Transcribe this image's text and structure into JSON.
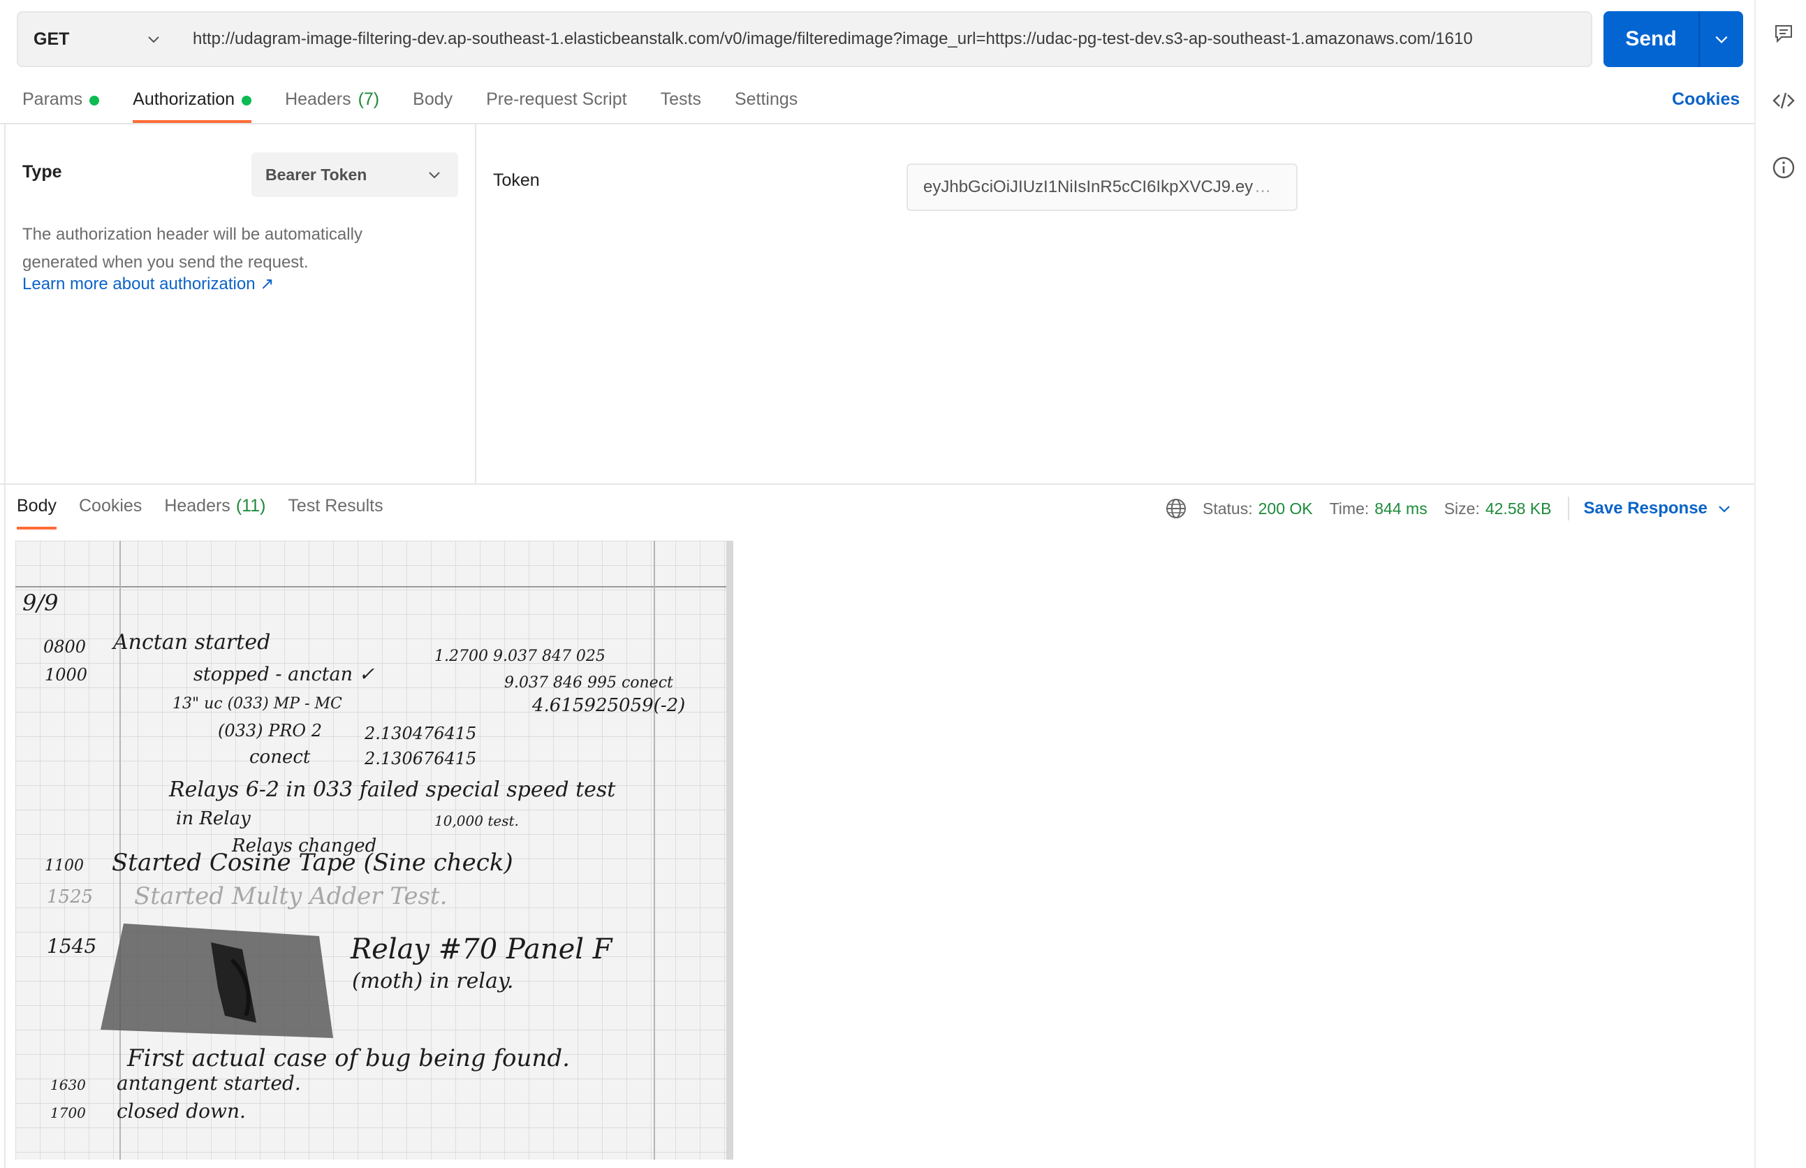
{
  "request": {
    "method": "GET",
    "url": "http://udagram-image-filtering-dev.ap-southeast-1.elasticbeanstalk.com/v0/image/filteredimage?image_url=https://udac-pg-test-dev.s3-ap-southeast-1.amazonaws.com/1610",
    "send_label": "Send"
  },
  "request_tabs": {
    "params": "Params",
    "authorization": "Authorization",
    "headers": "Headers",
    "headers_count": "(7)",
    "body": "Body",
    "prerequest": "Pre-request Script",
    "tests": "Tests",
    "settings": "Settings",
    "cookies": "Cookies"
  },
  "auth": {
    "type_label": "Type",
    "type_value": "Bearer Token",
    "help_text": "The authorization header will be automatically generated when you send the request.",
    "learn_more": "Learn more about authorization ↗",
    "token_label": "Token",
    "token_value": "eyJhbGciOiJIUzI1NiIsInR5cCI6IkpXVCJ9.ey"
  },
  "response_tabs": {
    "body": "Body",
    "cookies": "Cookies",
    "headers": "Headers",
    "headers_count": "(11)",
    "test_results": "Test Results"
  },
  "response_meta": {
    "status_label": "Status:",
    "status_value": "200 OK",
    "time_label": "Time:",
    "time_value": "844 ms",
    "size_label": "Size:",
    "size_value": "42.58 KB",
    "save_label": "Save Response"
  },
  "notebook": {
    "lines": [
      "9/9",
      "0800",
      "Anctan started",
      "1000",
      "stopped - anctan ✓",
      "1.2700  9.037 847 025",
      "9.037 846 995  conect",
      "13\" uc (033) MP - MC",
      "4.615925059(-2)",
      "(033) PRO 2",
      "2.130476415",
      "conect",
      "2.130676415",
      "Relays 6-2 in 033 failed special speed test",
      "in Relay",
      "10,000 test.",
      "Relays changed",
      "1100",
      "Started Cosine Tape (Sine check)",
      "1525",
      "Started Multy Adder Test.",
      "1545",
      "Relay #70 Panel F",
      "(moth) in relay.",
      "First actual case of bug being found.",
      "1630",
      "antangent started.",
      "1700",
      "closed down."
    ]
  },
  "colors": {
    "accent_orange": "#ff6c37",
    "send_blue": "#0265d2",
    "link_blue": "#0b63c7",
    "status_green": "#1d8a3a",
    "dot_green": "#0cbb52"
  }
}
